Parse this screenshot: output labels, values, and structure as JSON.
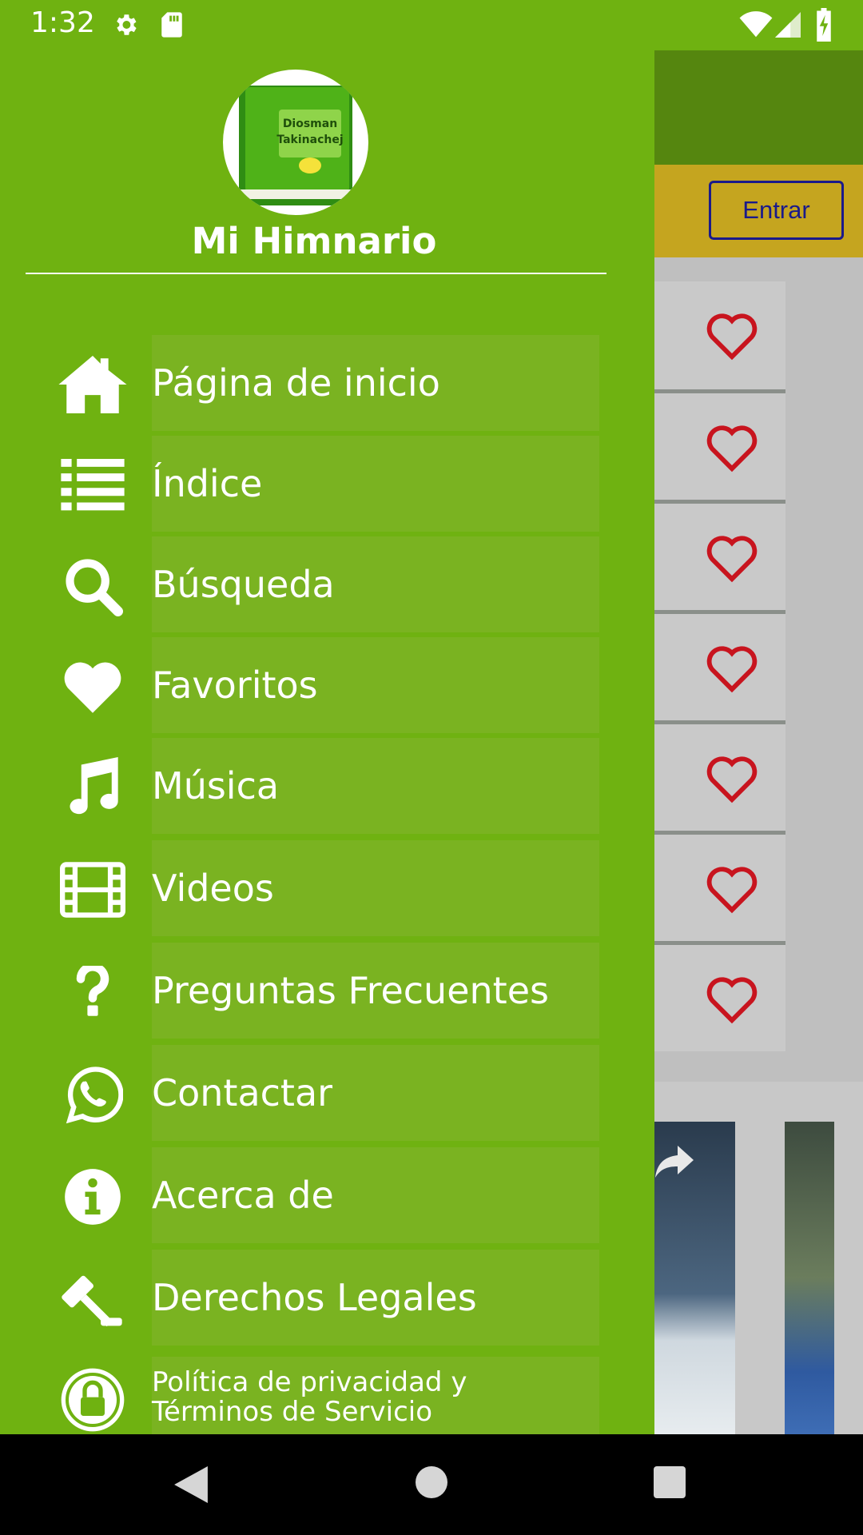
{
  "status_bar": {
    "time": "1:32",
    "left_icons": [
      "gear-icon",
      "sd-card-icon"
    ],
    "right_icons": [
      "wifi-icon",
      "signal-icon",
      "battery-charging-icon"
    ]
  },
  "background_app": {
    "login_button": "Entrar",
    "row_icons": [
      "heart-outline-icon",
      "heart-outline-icon",
      "heart-outline-icon",
      "heart-outline-icon",
      "heart-outline-icon",
      "heart-outline-icon",
      "heart-outline-icon"
    ],
    "share_icon": "share-arrow-icon"
  },
  "drawer": {
    "logo_text": [
      "Diosman",
      "Takinachej"
    ],
    "title": "Mi Himnario",
    "menu": [
      {
        "label": "Página de inicio",
        "icon": "home-icon"
      },
      {
        "label": "Índice",
        "icon": "list-icon"
      },
      {
        "label": "Búsqueda",
        "icon": "search-icon"
      },
      {
        "label": "Favoritos",
        "icon": "heart-icon"
      },
      {
        "label": "Música",
        "icon": "music-note-icon"
      },
      {
        "label": "Videos",
        "icon": "film-icon"
      },
      {
        "label": "Preguntas Frecuentes",
        "icon": "question-icon"
      },
      {
        "label": "Contactar",
        "icon": "whatsapp-icon"
      },
      {
        "label": "Acerca de",
        "icon": "info-icon"
      },
      {
        "label": "Derechos Legales",
        "icon": "gavel-icon"
      },
      {
        "label_line1": "Política de privacidad y",
        "label_line2": "Términos de Servicio",
        "icon": "lock-icon"
      }
    ]
  },
  "nav_bar": {
    "buttons": [
      "back-icon",
      "home-circle-icon",
      "recents-square-icon"
    ]
  },
  "colors": {
    "drawer_green": "#6fb211",
    "item_green": "#7ab321",
    "toolbar_green": "#55860f",
    "yellow_bar": "#c5a51f",
    "heart_red": "#c8141e",
    "button_blue": "#1a1a8a"
  }
}
